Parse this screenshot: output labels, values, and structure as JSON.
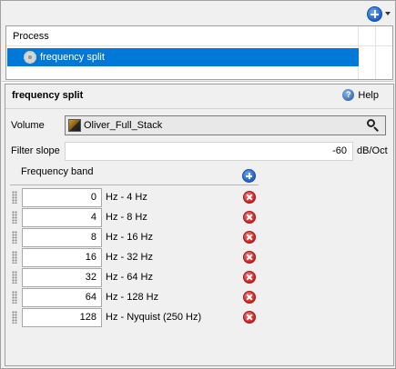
{
  "toolbar": {
    "add_icon": "add-circle-icon",
    "menu_icon": "dropdown-caret-icon"
  },
  "process_list": {
    "header": "Process",
    "rows": [
      {
        "name": "frequency split",
        "icon": "gear-icon",
        "selected": true
      }
    ]
  },
  "panel": {
    "title": "frequency split",
    "help_label": "Help",
    "volume_label": "Volume",
    "volume_value": "Oliver_Full_Stack",
    "filter_slope_label": "Filter slope",
    "filter_slope_value": "-60",
    "filter_slope_unit": "dB/Oct",
    "frequency_band_header": "Frequency band"
  },
  "bands": [
    {
      "value": "0",
      "range": "Hz - 4 Hz"
    },
    {
      "value": "4",
      "range": "Hz - 8 Hz"
    },
    {
      "value": "8",
      "range": "Hz - 16 Hz"
    },
    {
      "value": "16",
      "range": "Hz - 32 Hz"
    },
    {
      "value": "32",
      "range": "Hz - 64 Hz"
    },
    {
      "value": "64",
      "range": "Hz - 128 Hz"
    },
    {
      "value": "128",
      "range": "Hz - Nyquist (250 Hz)"
    }
  ],
  "colors": {
    "selection": "#0078d7",
    "add": "#1d5fc8",
    "remove": "#d02020"
  }
}
